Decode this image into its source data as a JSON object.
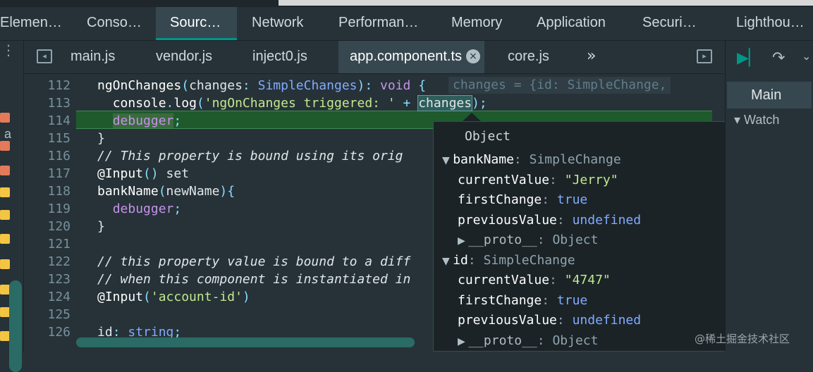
{
  "devtools_tabs": [
    "Elemen…",
    "Conso…",
    "Sourc…",
    "Network",
    "Performan…",
    "Memory",
    "Application",
    "Securi…",
    "Lighthou…"
  ],
  "active_tab": "Sourc…",
  "file_tabs": [
    "main.js",
    "vendor.js",
    "inject0.js",
    "app.component.ts",
    "core.js"
  ],
  "active_file": "app.component.ts",
  "close_glyph": "×",
  "more_tabs_glyph": "»",
  "left_panel_letter": "a",
  "code_lines": [
    {
      "n": "112",
      "text": "ngOnChanges(changes: SimpleChanges): void {"
    },
    {
      "n": "113",
      "text": "  console.log('ngOnChanges triggered: ' + changes);"
    },
    {
      "n": "114",
      "text": "  debugger;"
    },
    {
      "n": "115",
      "text": "}"
    },
    {
      "n": "116",
      "text": "// This property is bound using its orig"
    },
    {
      "n": "117",
      "text": "@Input() set"
    },
    {
      "n": "118",
      "text": "bankName(newName){"
    },
    {
      "n": "119",
      "text": "  debugger;"
    },
    {
      "n": "120",
      "text": "}"
    },
    {
      "n": "121",
      "text": ""
    },
    {
      "n": "122",
      "text": "// this property value is bound to a diff"
    },
    {
      "n": "123",
      "text": "// when this component is instantiated in"
    },
    {
      "n": "124",
      "text": "@Input('account-id')"
    },
    {
      "n": "125",
      "text": ""
    },
    {
      "n": "126",
      "text": "id: string;"
    }
  ],
  "inline_value": "changes = {id: SimpleChange,",
  "tooltip": {
    "title": "Object",
    "rows": [
      {
        "indent": 0,
        "arrow": "expanded",
        "key": "bankName",
        "sep": ": ",
        "value": "SimpleChange",
        "vclass": "vtype"
      },
      {
        "indent": 1,
        "arrow": "",
        "key": "currentValue",
        "sep": ": ",
        "value": "\"Jerry\"",
        "vclass": "vstr"
      },
      {
        "indent": 1,
        "arrow": "",
        "key": "firstChange",
        "sep": ": ",
        "value": "true",
        "vclass": "vbool"
      },
      {
        "indent": 1,
        "arrow": "",
        "key": "previousValue",
        "sep": ": ",
        "value": "undefined",
        "vclass": "vund"
      },
      {
        "indent": 1,
        "arrow": "collapsed",
        "key": "__proto__",
        "sep": ": ",
        "value": "Object",
        "vclass": "vtype"
      },
      {
        "indent": 0,
        "arrow": "expanded",
        "key": "id",
        "sep": ": ",
        "value": "SimpleChange",
        "vclass": "vtype"
      },
      {
        "indent": 1,
        "arrow": "",
        "key": "currentValue",
        "sep": ": ",
        "value": "\"4747\"",
        "vclass": "vstr"
      },
      {
        "indent": 1,
        "arrow": "",
        "key": "firstChange",
        "sep": ": ",
        "value": "true",
        "vclass": "vbool"
      },
      {
        "indent": 1,
        "arrow": "",
        "key": "previousValue",
        "sep": ": ",
        "value": "undefined",
        "vclass": "vund"
      },
      {
        "indent": 1,
        "arrow": "collapsed",
        "key": "__proto__",
        "sep": ": ",
        "value": "Object",
        "vclass": "vtype"
      }
    ]
  },
  "right_panel": {
    "main_tab": "Main",
    "watch_label": "Watch"
  },
  "watermark": "@稀土掘金技术社区",
  "colors": {
    "accent": "#009688",
    "background": "#263238",
    "highlight_line": "#1e5a2c"
  }
}
